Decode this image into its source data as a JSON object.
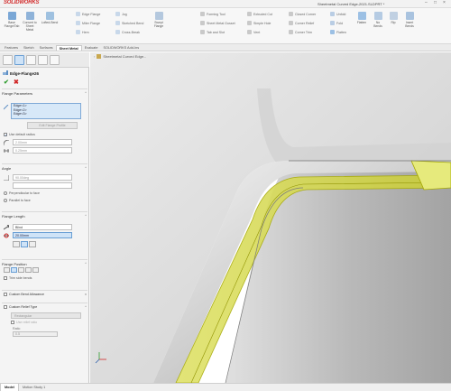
{
  "app": {
    "logo": "SOLIDWORKS",
    "window_title": "Sheetmetal Curved Edge-2021.SLDPRT *"
  },
  "ribbon": {
    "large": [
      {
        "label": "Base Flange/Tab",
        "color": "#7aa7d6"
      },
      {
        "label": "Convert to Sheet Metal",
        "color": "#8fb3d9"
      },
      {
        "label": "Lofted-Bend",
        "color": "#9fc1e0"
      },
      {
        "label": "Edge Flange",
        "color": "#c8d8ea"
      },
      {
        "label": "Forming Tool",
        "color": "#c9c9c9"
      },
      {
        "label": "Extruded Cut",
        "color": "#c9c9c9"
      },
      {
        "label": "Unfold",
        "color": "#b9cde4"
      },
      {
        "label": "Fold",
        "color": "#b9cde4"
      },
      {
        "label": "Flatten",
        "color": "#9cc0e4"
      },
      {
        "label": "No Bends",
        "color": "#b5cbe3"
      },
      {
        "label": "Rip",
        "color": "#c0d0e2"
      },
      {
        "label": "Insert Bends",
        "color": "#a9c3df"
      }
    ],
    "small": [
      {
        "label": "Edge Flange"
      },
      {
        "label": "Jog"
      },
      {
        "label": "Miter Flange"
      },
      {
        "label": "Sketched Bend"
      },
      {
        "label": "Hem"
      },
      {
        "label": "Cross-Break"
      },
      {
        "label": "Swept Flange"
      },
      {
        "label": "Forming Tool"
      },
      {
        "label": "Sheet Metal Gusset"
      },
      {
        "label": "Tab and Slot"
      },
      {
        "label": "Extruded Cut"
      },
      {
        "label": "Simple Hole"
      },
      {
        "label": "Vent"
      },
      {
        "label": "Closed Corner"
      },
      {
        "label": "Corner Relief"
      },
      {
        "label": "Corner Trim"
      },
      {
        "label": "Unfold"
      },
      {
        "label": "Fold"
      },
      {
        "label": "Flatten"
      }
    ]
  },
  "tabs": [
    "Features",
    "Sketch",
    "Surfaces",
    "Sheet Metal",
    "Evaluate",
    "SOLIDWORKS Add-Ins"
  ],
  "active_tab": "Sheet Metal",
  "property_manager": {
    "title": "Edge-Flange26",
    "flange_parameters": {
      "heading": "Flange Parameters",
      "edges": [
        "Edge<1>",
        "Edge<2>",
        "Edge<3>"
      ],
      "edit_profile": "Edit Flange Profile",
      "use_default_radius": "Use default radius",
      "radius": "2.00mm",
      "gap": "0.25mm"
    },
    "angle": {
      "heading": "Angle",
      "value": "90.00deg",
      "perpendicular": "Perpendicular to face",
      "parallel": "Parallel to face"
    },
    "flange_length": {
      "heading": "Flange Length",
      "end_condition": "Blind",
      "length": "20.00mm"
    },
    "flange_position": {
      "heading": "Flange Position",
      "trim_side_bends": "Trim side bends"
    },
    "custom_bend_allowance": "Custom Bend Allowance",
    "custom_relief_type": {
      "heading": "Custom Relief Type",
      "type": "Rectangular",
      "use_relief_ratio": "Use relief ratio",
      "ratio_label": "Ratio",
      "ratio_value": "0.5"
    }
  },
  "viewport": {
    "tree_chip": "Sheetmetal Curved Edge..."
  },
  "bottom_tabs": [
    "Model",
    "Motion Study 1"
  ],
  "active_bottom_tab": "Model",
  "colors": {
    "accent": "#d32f2f",
    "selection": "#d7e8f8",
    "highlight_flange": "#d8dc2a"
  }
}
